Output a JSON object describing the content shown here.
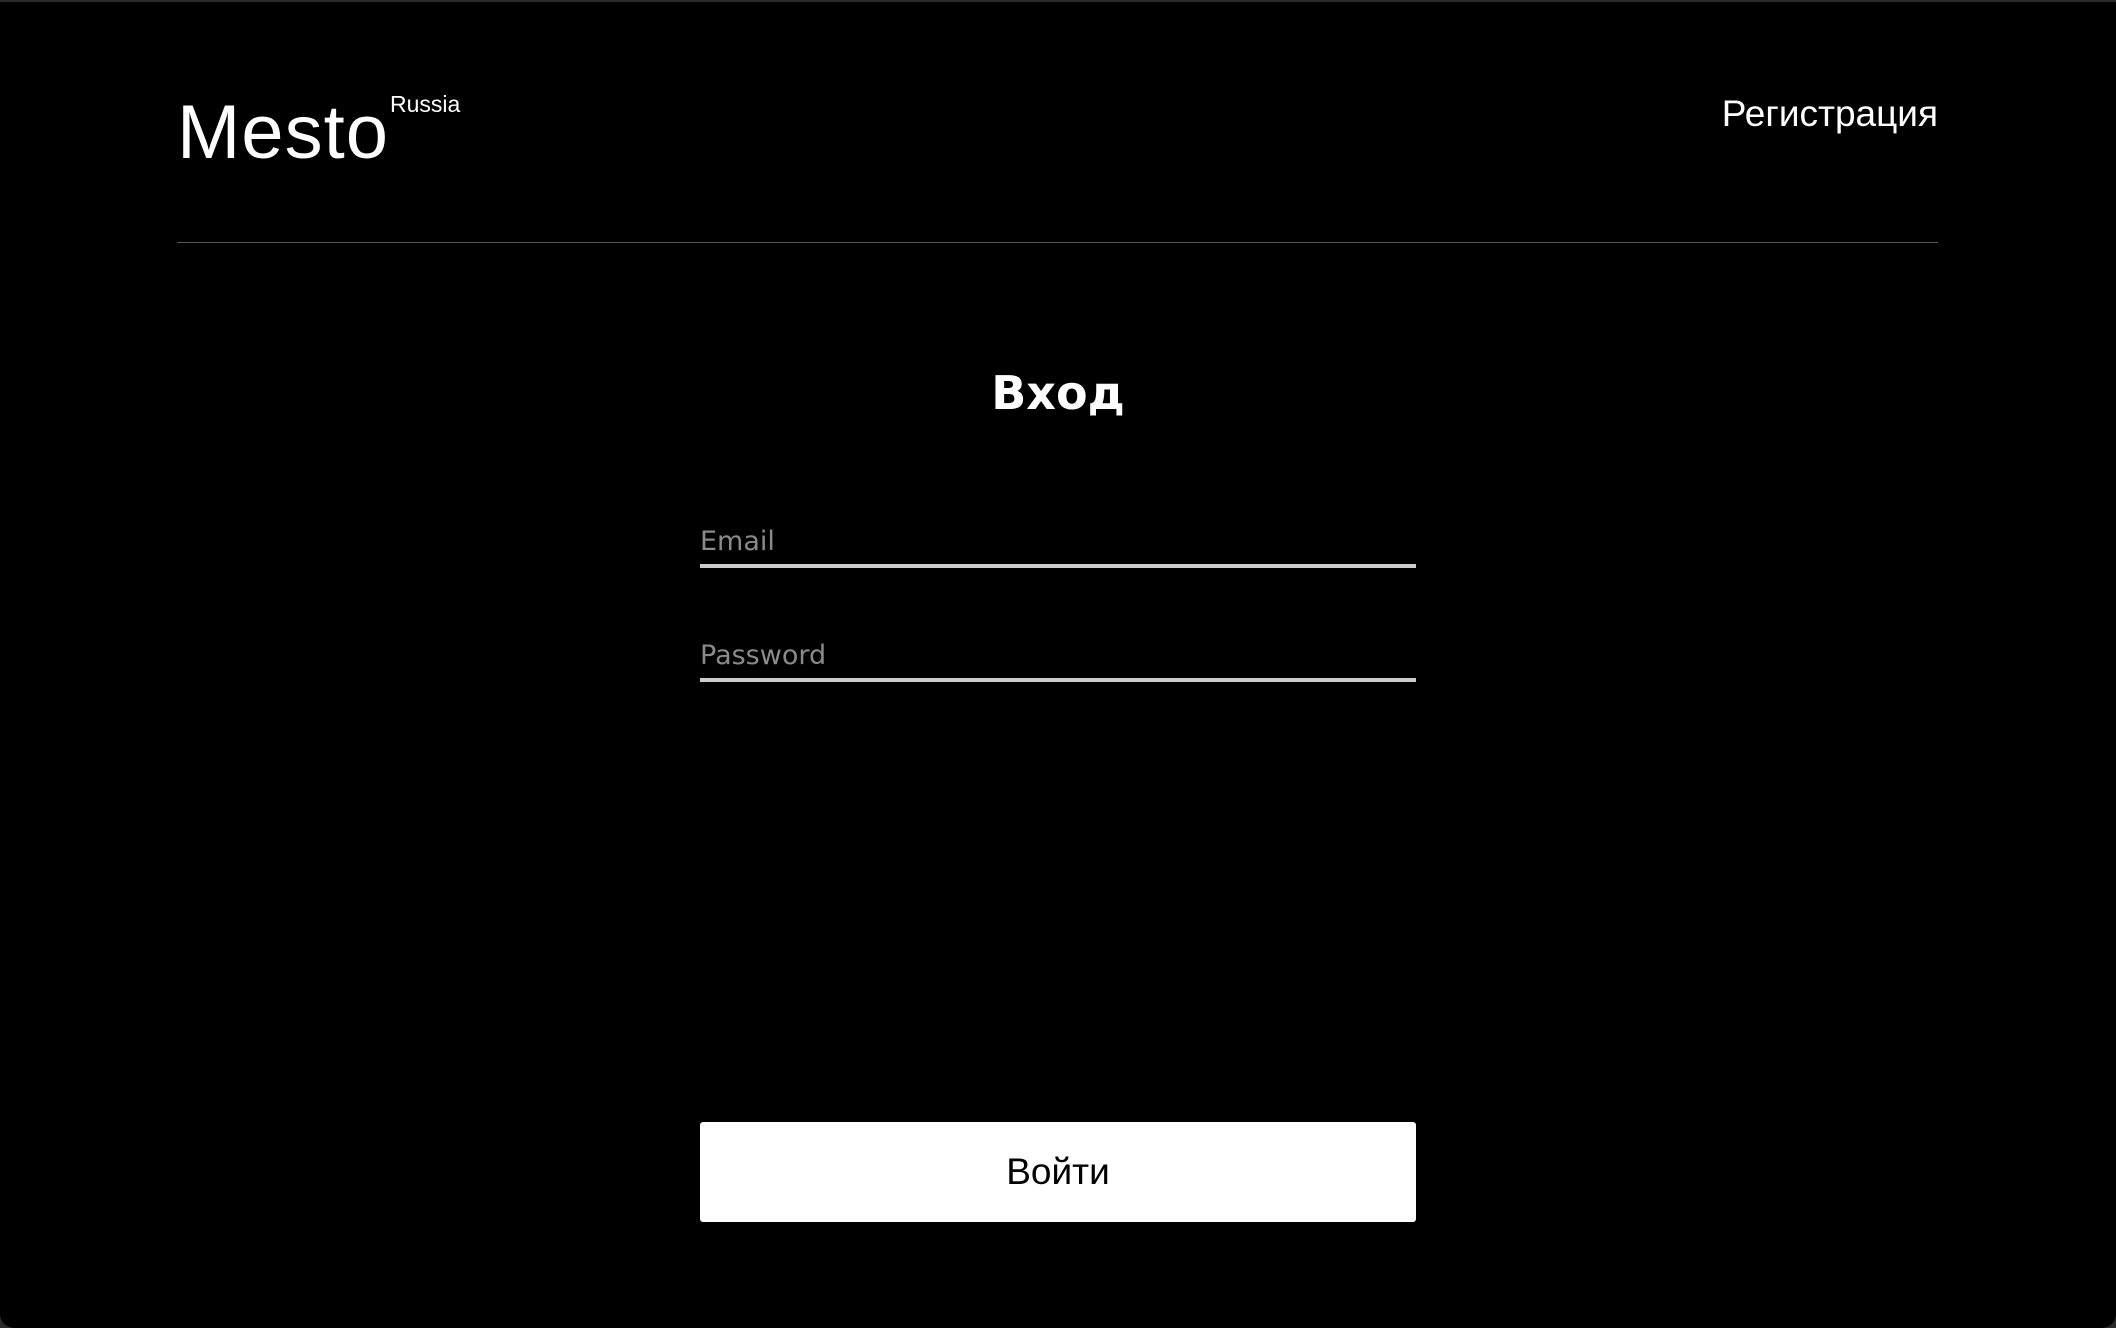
{
  "header": {
    "logo_text": "Mesto",
    "logo_superscript": "Russia",
    "register_link": "Регистрация"
  },
  "login": {
    "title": "Вход",
    "email_placeholder": "Email",
    "password_placeholder": "Password",
    "submit_label": "Войти"
  },
  "colors": {
    "background": "#000000",
    "text": "#ffffff",
    "placeholder": "#8a8a8a",
    "field_underline": "#cccccc",
    "header_divider": "#545454",
    "button_background": "#ffffff",
    "button_text": "#000000"
  }
}
